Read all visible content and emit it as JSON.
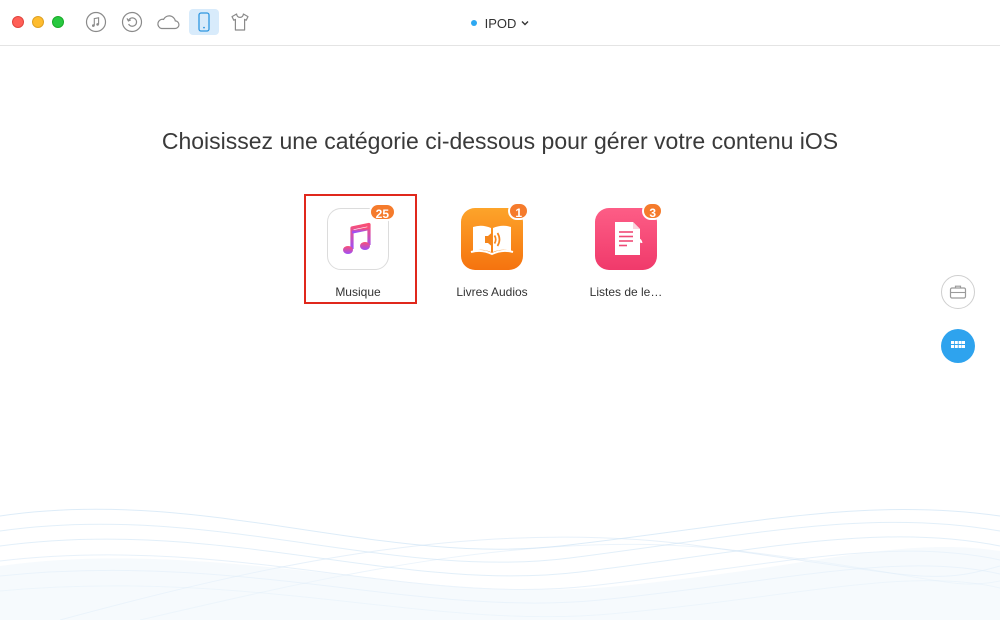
{
  "window": {
    "device_name": "IPOD"
  },
  "toolbar": {
    "items": [
      {
        "icon": "music-note-icon"
      },
      {
        "icon": "restore-icon"
      },
      {
        "icon": "cloud-icon"
      },
      {
        "icon": "phone-icon",
        "active": true
      },
      {
        "icon": "tshirt-icon"
      }
    ]
  },
  "main": {
    "headline": "Choisissez une catégorie ci-dessous pour gérer votre contenu iOS",
    "categories": [
      {
        "label": "Musique",
        "badge": "25",
        "icon": "music-app-icon",
        "selected": true
      },
      {
        "label": "Livres Audios",
        "badge": "1",
        "icon": "audiobook-icon"
      },
      {
        "label": "Listes de le…",
        "badge": "3",
        "icon": "playlist-icon"
      }
    ]
  },
  "sidebar": {
    "buttons": [
      {
        "icon": "toolbox-icon"
      },
      {
        "icon": "grid-icon"
      }
    ]
  },
  "colors": {
    "accent": "#2ea3ee",
    "badge": "#f57b2c",
    "selection": "#e0281c"
  }
}
